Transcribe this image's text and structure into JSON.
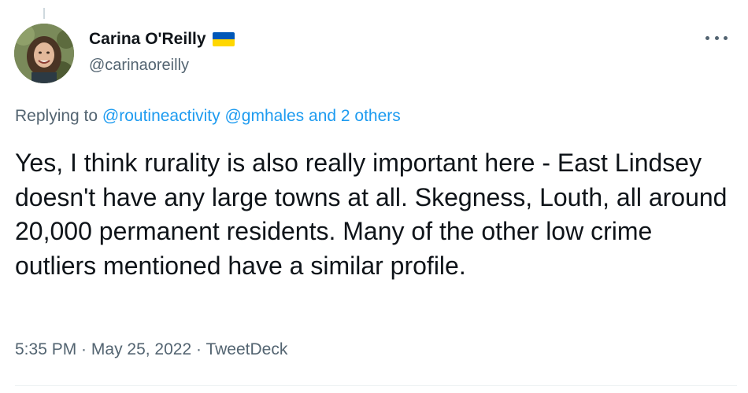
{
  "author": {
    "display_name": "Carina O'Reilly",
    "handle": "@carinaoreilly",
    "flag_icon": "ukraine-flag-icon",
    "flag_colors": [
      "#0057b7",
      "#ffd700"
    ]
  },
  "reply": {
    "prefix": "Replying to",
    "mention_1": "@routineactivity",
    "mention_2": "@gmhales",
    "others": "and 2 others"
  },
  "tweet": {
    "text": "Yes, I think rurality is also really important here - East Lindsey doesn't have any large towns at all. Skegness, Louth, all around 20,000 permanent residents. Many of the other low crime outliers mentioned have a similar profile."
  },
  "meta": {
    "time": "5:35 PM",
    "separator_1": " · ",
    "date": "May 25, 2022",
    "separator_2": " · ",
    "source": "TweetDeck"
  },
  "colors": {
    "link": "#1d9bf0",
    "secondary_text": "#536471",
    "primary_text": "#0f1419"
  },
  "icons": {
    "more": "more-options-icon"
  }
}
